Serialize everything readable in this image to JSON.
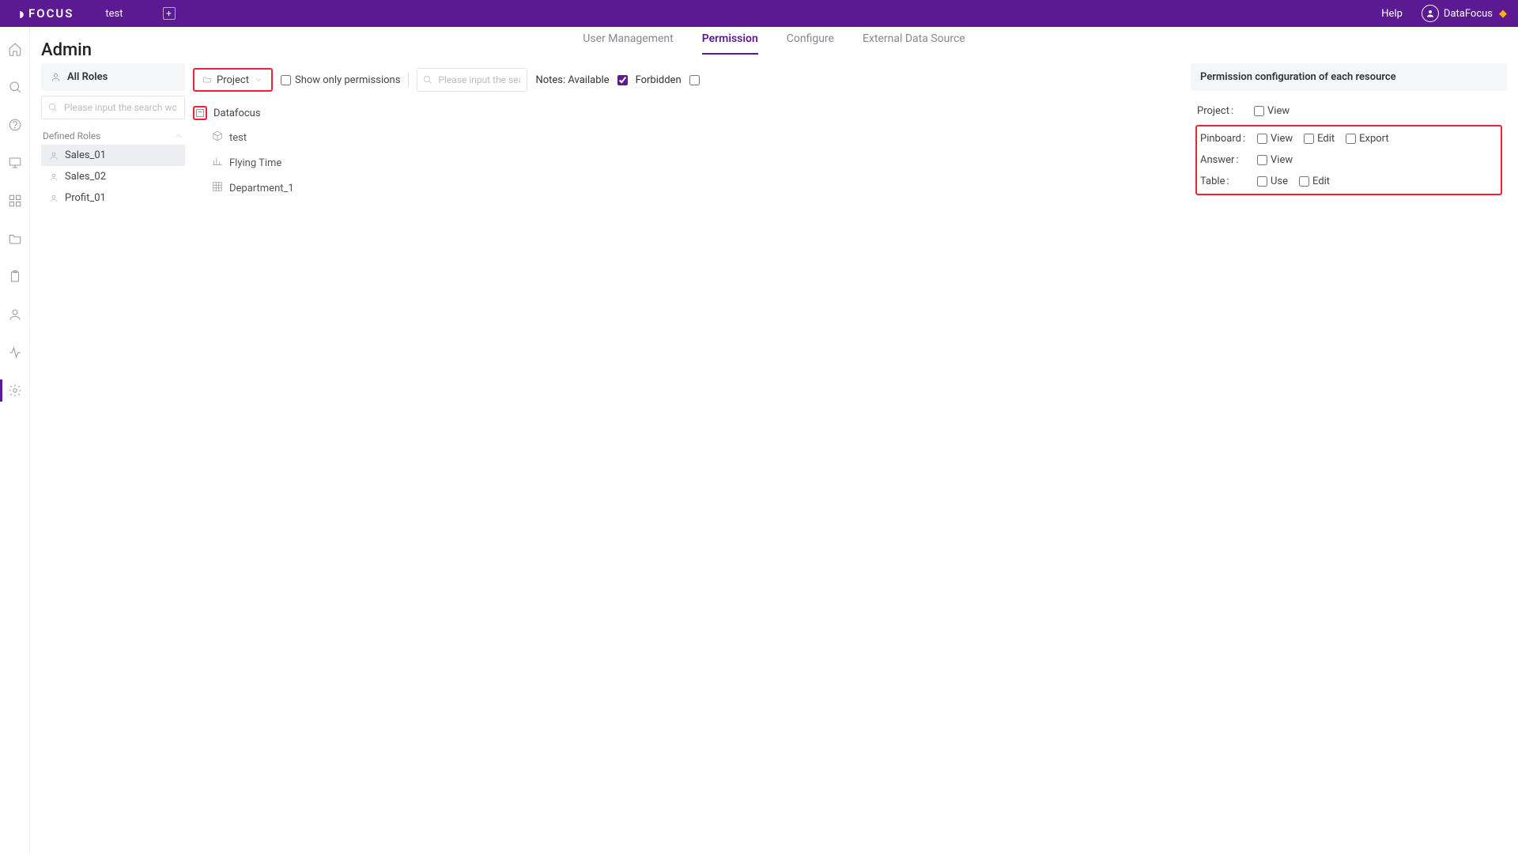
{
  "topbar": {
    "logo": "FOCUS",
    "tab": "test",
    "help": "Help",
    "username": "DataFocus"
  },
  "page": {
    "title": "Admin"
  },
  "subnav": {
    "items": [
      "User Management",
      "Permission",
      "Configure",
      "External Data Source"
    ],
    "active": "Permission"
  },
  "roles": {
    "header": "All Roles",
    "search_placeholder": "Please input the search words",
    "group_label": "Defined Roles",
    "items": [
      "Sales_01",
      "Sales_02",
      "Profit_01"
    ],
    "selected": "Sales_01"
  },
  "toolbar": {
    "project_label": "Project",
    "show_only": "Show only permissions",
    "search_placeholder": "Please input the search w",
    "notes_label": "Notes:",
    "available_label": "Available",
    "forbidden_label": "Forbidden"
  },
  "tree": {
    "root": "Datafocus",
    "children": [
      {
        "icon": "cube",
        "label": "test"
      },
      {
        "icon": "chart",
        "label": "Flying Time"
      },
      {
        "icon": "grid",
        "label": "Department_1"
      }
    ]
  },
  "perm": {
    "header": "Permission configuration of each resource",
    "rows": [
      {
        "label": "Project",
        "opts": [
          "View"
        ]
      },
      {
        "label": "Pinboard",
        "opts": [
          "View",
          "Edit",
          "Export"
        ]
      },
      {
        "label": "Answer",
        "opts": [
          "View"
        ]
      },
      {
        "label": "Table",
        "opts": [
          "Use",
          "Edit"
        ]
      }
    ]
  },
  "rail_icons": [
    "home",
    "search",
    "help",
    "present",
    "grid",
    "folder",
    "clipboard",
    "user",
    "activity",
    "settings"
  ]
}
